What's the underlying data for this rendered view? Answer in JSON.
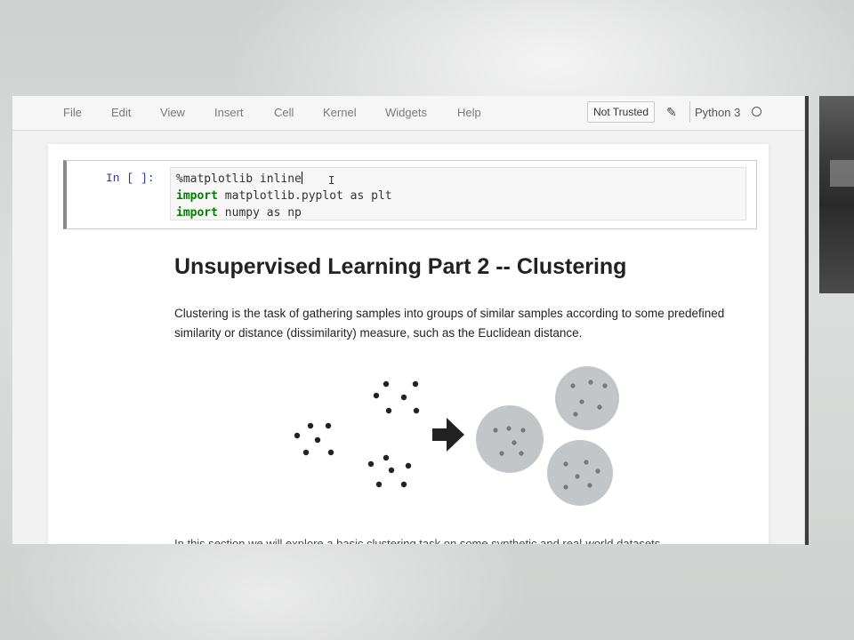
{
  "menu": {
    "items": [
      "File",
      "Edit",
      "View",
      "Insert",
      "Cell",
      "Kernel",
      "Widgets",
      "Help"
    ],
    "trust_label": "Not Trusted",
    "kernel_name": "Python 3"
  },
  "code_cell": {
    "prompt": "In [ ]:",
    "lines": [
      "%matplotlib inline",
      "import matplotlib.pyplot as plt",
      "import numpy as np"
    ]
  },
  "markdown": {
    "heading": "Unsupervised Learning Part 2 -- Clustering",
    "paragraph": "Clustering is the task of gathering samples into groups of similar samples according to some predefined similarity or distance (dissimilarity) measure, such as the Euclidean distance.",
    "cut_off_line": "In this section we will explore a basic clustering task on some synthetic and real-world datasets."
  }
}
